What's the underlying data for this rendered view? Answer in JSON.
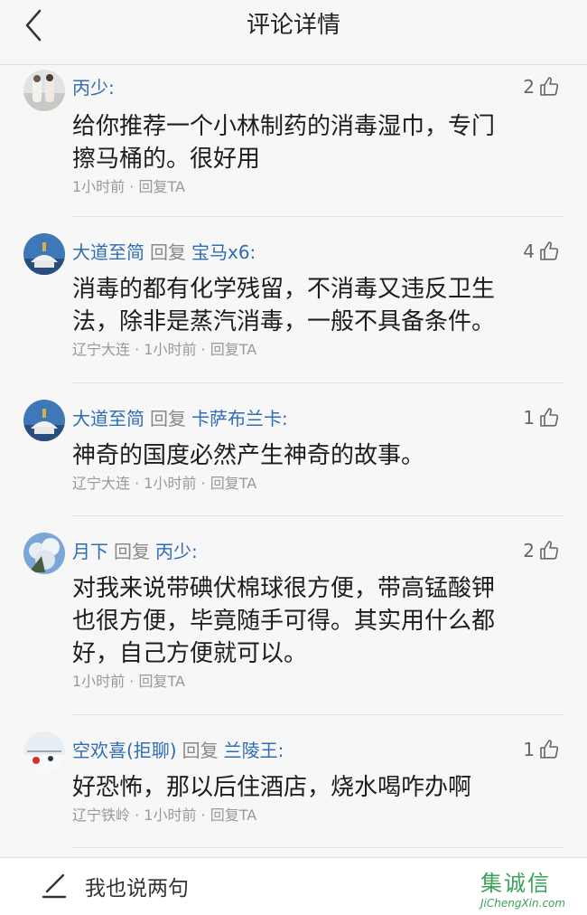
{
  "header": {
    "title": "评论详情"
  },
  "comments": [
    {
      "user": "丙少:",
      "reply_word": "",
      "reply_to": "",
      "likes": "2",
      "content_lines": [
        "给你推荐一个小林制药的消毒湿巾，专门",
        "擦马桶的。很好用"
      ],
      "meta": "1小时前 · 回复TA",
      "location": "",
      "time": "1小时前",
      "reply_action": "回复TA"
    },
    {
      "user": "大道至简",
      "reply_word": "回复",
      "reply_to": "宝马x6:",
      "likes": "4",
      "content_lines": [
        "消毒的都有化学残留，不消毒又违反卫生",
        "法，除非是蒸汽消毒，一般不具备条件。"
      ],
      "location": "辽宁大连",
      "time": "1小时前",
      "reply_action": "回复TA"
    },
    {
      "user": "大道至简",
      "reply_word": "回复",
      "reply_to": "卡萨布兰卡:",
      "likes": "1",
      "content_lines": [
        "神奇的国度必然产生神奇的故事。"
      ],
      "location": "辽宁大连",
      "time": "1小时前",
      "reply_action": "回复TA"
    },
    {
      "user": "月下",
      "reply_word": "回复",
      "reply_to": "丙少:",
      "likes": "2",
      "content_lines": [
        "对我来说带碘伏棉球很方便，带高锰酸钾",
        "也很方便，毕竟随手可得。其实用什么都",
        "好，自己方便就可以。"
      ],
      "location": "",
      "time": "1小时前",
      "reply_action": "回复TA"
    },
    {
      "user": "空欢喜(拒聊)",
      "reply_word": "回复",
      "reply_to": "兰陵王:",
      "likes": "1",
      "content_lines": [
        "好恐怖，那以后住酒店，烧水喝咋办啊"
      ],
      "location": "辽宁铁岭",
      "time": "1小时前",
      "reply_action": "回复TA"
    }
  ],
  "footer": {
    "compose_placeholder": "我也说两句"
  },
  "watermark": {
    "cn": "集诚信",
    "en": "JiChengXin.com"
  },
  "colors": {
    "username": "#2f6db3",
    "meta": "#999999",
    "watermark": "#3aa35a"
  }
}
